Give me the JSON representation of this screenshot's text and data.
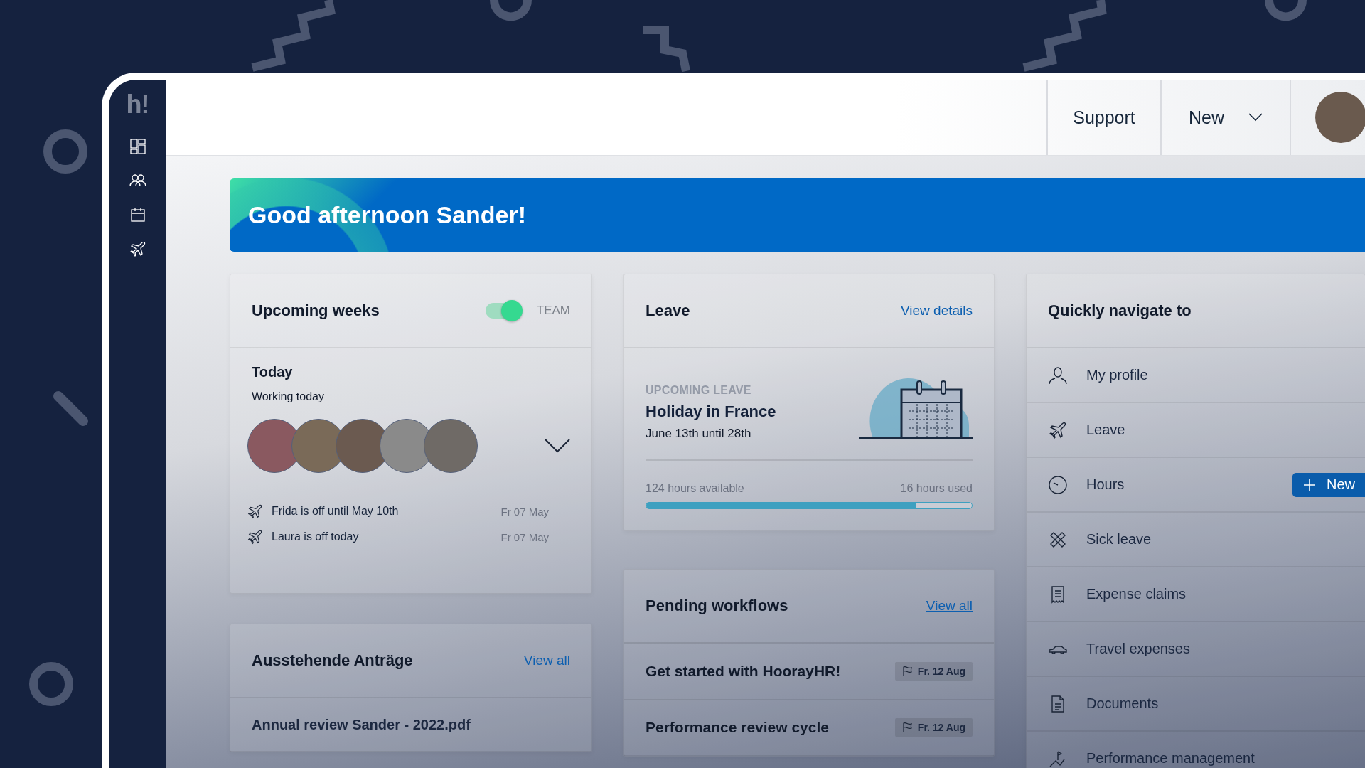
{
  "sidebar": {
    "logo": "h!"
  },
  "header": {
    "support": "Support",
    "new_menu": "New"
  },
  "banner": {
    "greeting": "Good afternoon Sander!"
  },
  "upcoming": {
    "title": "Upcoming weeks",
    "toggle": {
      "label": "TEAM",
      "on": true
    },
    "today": "Today",
    "working_today": "Working today",
    "absences": [
      {
        "text": "Frida is off until May 10th",
        "date": "Fr 07 May"
      },
      {
        "text": "Laura is off today",
        "date": "Fr 07 May"
      }
    ]
  },
  "requests": {
    "title": "Ausstehende Anträge",
    "link": "View all",
    "items": [
      "Annual review Sander - 2022.pdf"
    ]
  },
  "leave": {
    "title": "Leave",
    "link": "View details",
    "eyebrow": "UPCOMING LEAVE",
    "name": "Holiday in France",
    "dates": "June 13th until 28th",
    "available": "124 hours available",
    "used": "16 hours used",
    "level": 0.83
  },
  "workflows": {
    "title": "Pending workflows",
    "link": "View all",
    "items": [
      {
        "name": "Get started with HoorayHR!",
        "due": "Fr. 12 Aug"
      },
      {
        "name": "Performance review cycle",
        "due": "Fr. 12 Aug"
      }
    ]
  },
  "quick_nav": {
    "title": "Quickly navigate to",
    "items": [
      {
        "kind": "profile",
        "label": "My profile"
      },
      {
        "kind": "leave",
        "label": "Leave"
      },
      {
        "kind": "hours",
        "label": "Hours",
        "action": "New"
      },
      {
        "kind": "sick",
        "label": "Sick leave"
      },
      {
        "kind": "expense",
        "label": "Expense claims"
      },
      {
        "kind": "travel",
        "label": "Travel expenses"
      },
      {
        "kind": "documents",
        "label": "Documents"
      },
      {
        "kind": "performance",
        "label": "Performance management"
      }
    ]
  }
}
